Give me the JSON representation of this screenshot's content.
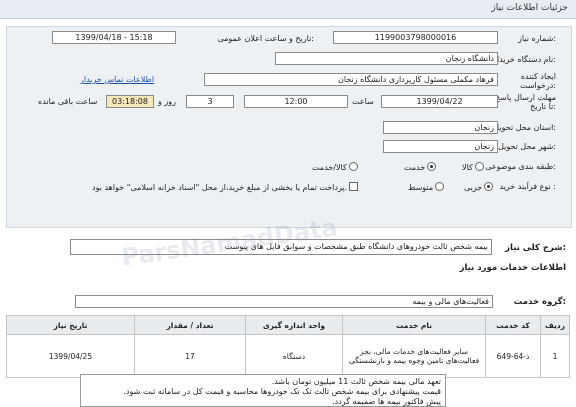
{
  "header": {
    "title": "جزئیات اطلاعات نیاز"
  },
  "need_number": {
    "label": "شماره نیاز:",
    "value": "1199003798000016"
  },
  "announce_datetime": {
    "label": "تاریخ و ساعت اعلان عمومی:",
    "value": "1399/04/18 - 15:18"
  },
  "buyer_org": {
    "label": "نام دستگاه خریدار:",
    "value": "دانشگاه زنجان"
  },
  "creator": {
    "label": "ایجاد کننده درخواست:",
    "value": "فرهاد مکملی مسئول کارپردازی دانشگاه زنجان",
    "contact_link": "اطلاعات تماس خریدار"
  },
  "deadline": {
    "label": "مهلت ارسال پاسخ: تا تاریخ:",
    "date": "1399/04/22",
    "time_label": "ساعت",
    "time": "12:00",
    "days": "3",
    "days_label": "روز و",
    "remaining": "03:18:08",
    "remaining_label": "ساعت باقی مانده"
  },
  "delivery_province": {
    "label": "استان محل تحویل:",
    "value": "زنجان"
  },
  "delivery_city": {
    "label": "شهر محل تحویل:",
    "value": "زنجان"
  },
  "category": {
    "label": "طبقه بندی موضوعی:",
    "options": [
      "کالا",
      "خدمت",
      "کالا/خدمت"
    ],
    "selected": "خدمت"
  },
  "purchase_type": {
    "label": "نوع فرآیند خرید :",
    "options": [
      "جزیی",
      "متوسط"
    ],
    "selected": "جزیی",
    "payment_note": "پرداخت تمام یا بخشی از مبلغ خرید،از محل \"اسناد خزانه اسلامی\" خواهد بود."
  },
  "summary": {
    "label": "شرح کلی نیاز:",
    "value": "بیمه شخص ثالث خودروهای دانشگاه طبق مشخصات و سوابق فایل های پیوست"
  },
  "services_title": "اطلاعات خدمات مورد نیاز",
  "service_group": {
    "label": "گروه خدمت:",
    "value": "فعالیت‌های مالی و بیمه"
  },
  "table": {
    "headers": [
      "ردیف",
      "کد خدمت",
      "نام خدمت",
      "واحد اندازه گیری",
      "تعداد / مقدار",
      "تاریخ نیاز"
    ],
    "rows": [
      [
        "1",
        "ذ-64-649",
        "سایر فعالیت‌های خدمات مالی، بجز فعالیت‌های تامین وجوه بیمه و بازنشستگی",
        "دستگاه",
        "17",
        "1399/04/25"
      ]
    ]
  },
  "notes": [
    "تعهد مالی بیمه شخص ثالث 11 میلیون تومان باشد.",
    "قیمت پیشنهادی برای بیمه شخص ثالث تک تک خودروها محاسبه و قیمت کل در سامانه ثبت شود.",
    "پیش فاکتور بیمه ها ضمیمه گردد."
  ],
  "watermark": "ParsNamadData"
}
